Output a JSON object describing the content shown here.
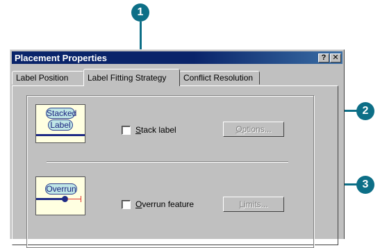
{
  "callouts": [
    "1",
    "2",
    "3"
  ],
  "colors": {
    "callout": "#0d6f87",
    "title_bar": "#0a246a",
    "dialog": "#c0c0c0",
    "preview_bg": "#ffffe1"
  },
  "window": {
    "title": "Placement Properties",
    "help_button": "?",
    "close_button": "✕"
  },
  "tabs": [
    {
      "label": "Label Position",
      "active": false
    },
    {
      "label": "Label Fitting Strategy",
      "active": true
    },
    {
      "label": "Conflict Resolution",
      "active": false
    }
  ],
  "stacked": {
    "preview_lines": [
      "Stacked",
      "Label"
    ],
    "checkbox_label_mnemonic": "S",
    "checkbox_label_rest": "tack label",
    "checked": false,
    "button_mnemonic": "O",
    "button_rest": "ptions...",
    "button_enabled": false
  },
  "overrun": {
    "preview_text": "Overrun",
    "checkbox_label_mnemonic": "O",
    "checkbox_label_rest": "verrun feature",
    "checked": false,
    "button_mnemonic": "L",
    "button_rest": "imits...",
    "button_enabled": false
  }
}
